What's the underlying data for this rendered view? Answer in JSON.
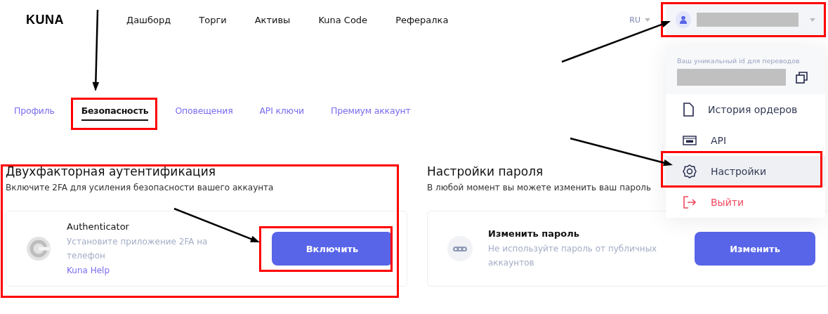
{
  "header": {
    "logo": "KUNA",
    "nav": [
      {
        "label": "Дашборд"
      },
      {
        "label": "Торги"
      },
      {
        "label": "Активы"
      },
      {
        "label": "Kuna Code"
      },
      {
        "label": "Рефералка"
      }
    ],
    "language": "RU"
  },
  "tabs": [
    {
      "label": "Профиль",
      "selected": false
    },
    {
      "label": "Безопасность",
      "selected": true
    },
    {
      "label": "Оповещения",
      "selected": false
    },
    {
      "label": "API ключи",
      "selected": false
    },
    {
      "label": "Премиум аккаунт",
      "selected": false
    }
  ],
  "sections": [
    {
      "title": "Двухфакторная аутентификация",
      "subtitle": "Включите 2FA для усиления безопасности вашего аккаунта",
      "card": {
        "kind": "authenticator",
        "title": "Authenticator",
        "description": "Установите приложение 2FA на телефон",
        "link": "Kuna Help",
        "button": "Включить"
      }
    },
    {
      "title": "Настройки пароля",
      "subtitle": "В любой момент вы можете изменить ваш пароль",
      "card": {
        "kind": "password",
        "title": "Изменить пароль",
        "description": "Не используйте пароль от публичных аккаунтов",
        "button": "Изменить"
      }
    }
  ],
  "user_menu": {
    "id_label": "Ваш уникальный id для переводов",
    "items": [
      {
        "kind": "file",
        "label": "История ордеров",
        "selected": false
      },
      {
        "kind": "api",
        "label": "API",
        "selected": false
      },
      {
        "kind": "gear",
        "label": "Настройки",
        "selected": true
      },
      {
        "kind": "logout",
        "label": "Выйти",
        "selected": false
      }
    ]
  }
}
